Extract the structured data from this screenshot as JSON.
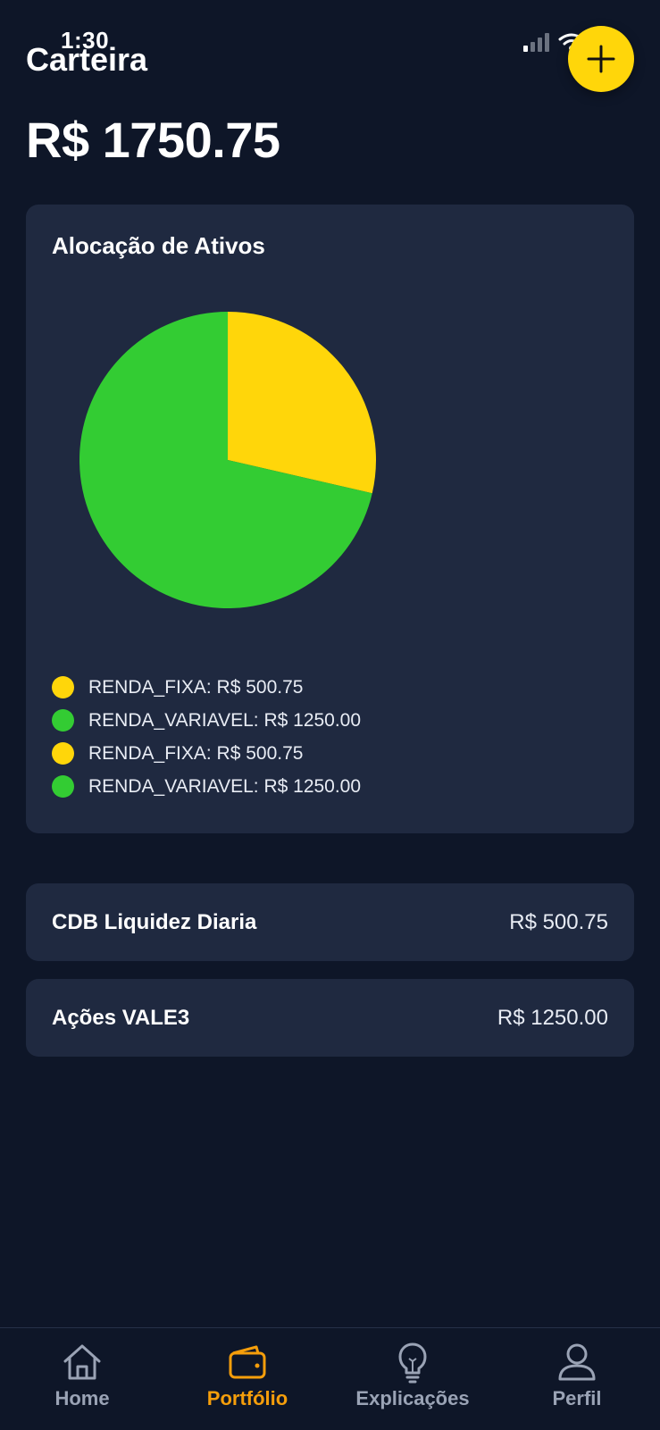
{
  "status_bar": {
    "time": "1:30"
  },
  "header": {
    "title": "Carteira",
    "add_icon": "plus-icon"
  },
  "portfolio": {
    "total": "R$ 1750.75"
  },
  "allocation": {
    "title": "Alocação de Ativos",
    "legend": [
      {
        "label": "RENDA_FIXA: R$ 500.75",
        "color": "#ffd60a"
      },
      {
        "label": "RENDA_VARIAVEL: R$ 1250.00",
        "color": "#33cc33"
      },
      {
        "label": "RENDA_FIXA: R$ 500.75",
        "color": "#ffd60a"
      },
      {
        "label": "RENDA_VARIAVEL: R$ 1250.00",
        "color": "#33cc33"
      }
    ]
  },
  "chart_data": {
    "type": "pie",
    "categories": [
      "RENDA_FIXA",
      "RENDA_VARIAVEL"
    ],
    "values": [
      500.75,
      1250.0
    ],
    "colors": [
      "#ffd60a",
      "#33cc33"
    ]
  },
  "assets": [
    {
      "name": "CDB Liquidez Diaria",
      "value": "R$ 500.75"
    },
    {
      "name": "Ações VALE3",
      "value": "R$ 1250.00"
    }
  ],
  "tabs": [
    {
      "label": "Home",
      "icon": "home-icon",
      "active": false
    },
    {
      "label": "Portfólio",
      "icon": "wallet-icon",
      "active": true
    },
    {
      "label": "Explicações",
      "icon": "lightbulb-icon",
      "active": false
    },
    {
      "label": "Perfil",
      "icon": "user-icon",
      "active": false
    }
  ],
  "colors": {
    "background": "#0e1628",
    "card": "#1f2940",
    "accent": "#ffd60a",
    "active_tab": "#f59e0b"
  }
}
